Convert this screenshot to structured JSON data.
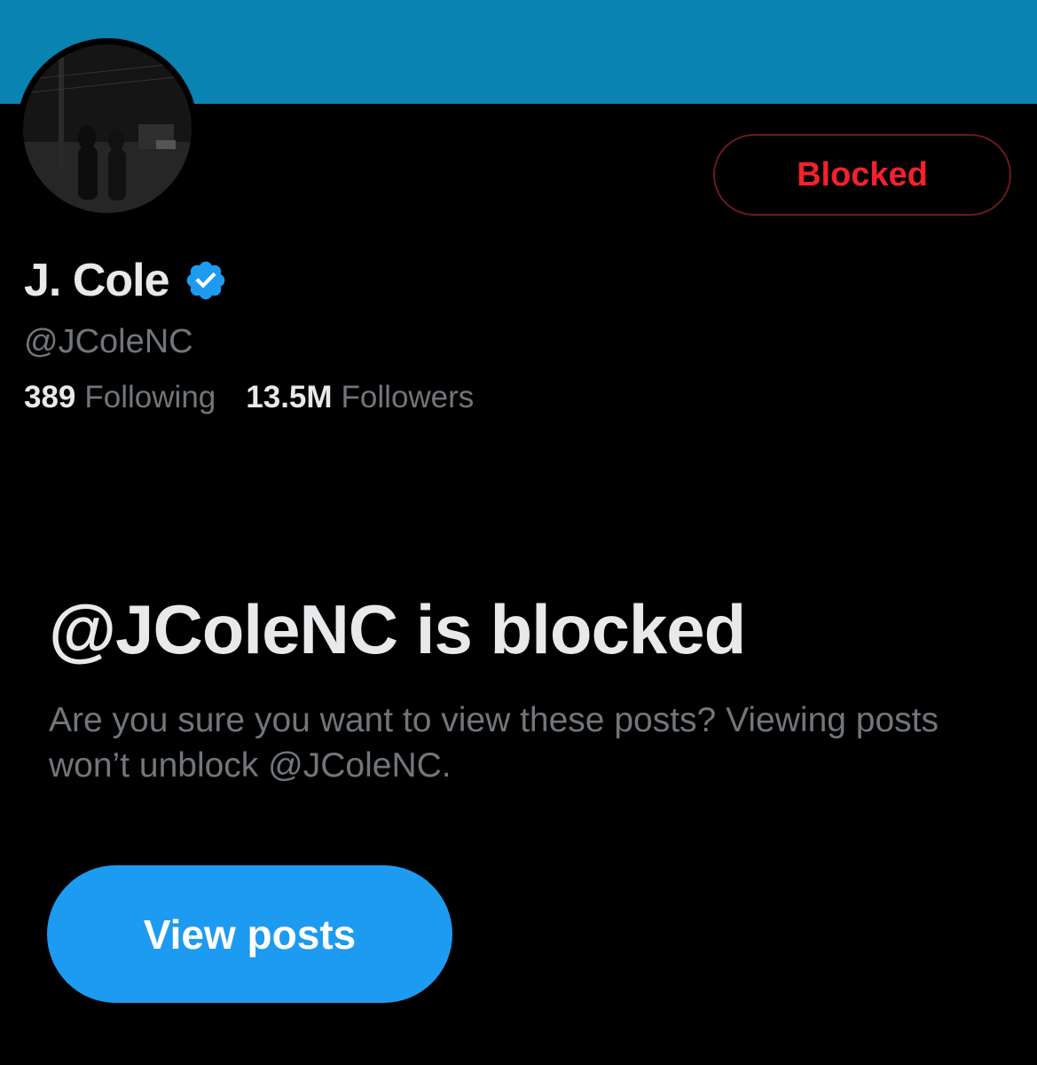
{
  "profile": {
    "display_name": "J. Cole",
    "handle": "@JColeNC",
    "following_count": "389",
    "following_label": "Following",
    "followers_count": "13.5M",
    "followers_label": "Followers",
    "block_button_label": "Blocked"
  },
  "blocked_notice": {
    "heading": "@JColeNC is blocked",
    "description": "Are you sure you want to view these posts? Viewing posts won’t unblock @JColeNC.",
    "view_button_label": "View posts"
  },
  "icons": {
    "verified": "verified-check-icon"
  },
  "colors": {
    "banner": "#0a82b2",
    "background": "#000000",
    "blocked_text": "#f4212e",
    "primary_button": "#1d9bf0",
    "secondary_text": "#71767b",
    "verified": "#1d9bf0"
  }
}
